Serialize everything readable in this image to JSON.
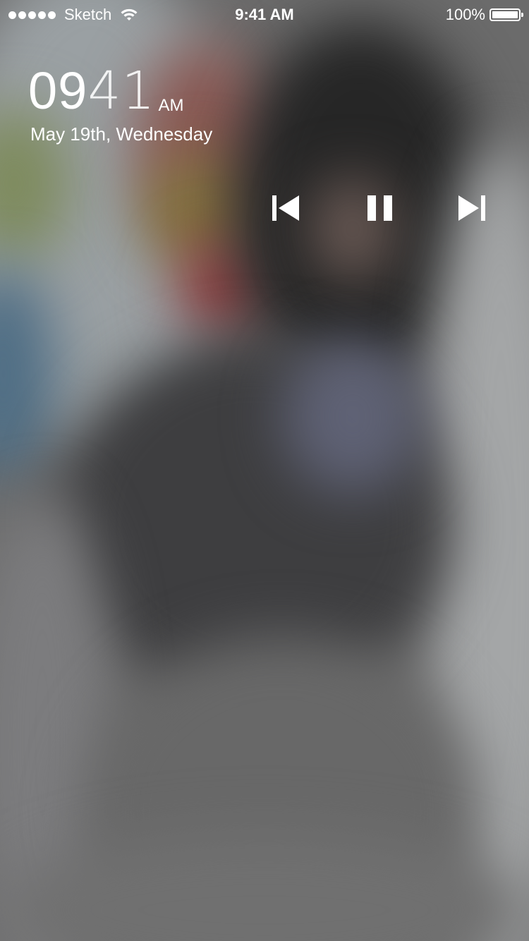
{
  "status_bar": {
    "carrier": "Sketch",
    "time": "9:41 AM",
    "battery": "100%",
    "signal_bars": 5,
    "battery_level": 1.0
  },
  "lock_screen": {
    "clock_hours": "09",
    "clock_minutes": "41",
    "clock_ampm": "AM",
    "date": "May 19th, Wednesday"
  },
  "media_controls": {
    "previous_icon": "skip-previous-icon",
    "pause_icon": "pause-icon",
    "next_icon": "skip-next-icon"
  },
  "colors": {
    "text": "#ffffff",
    "background": "#6b6b6b"
  }
}
